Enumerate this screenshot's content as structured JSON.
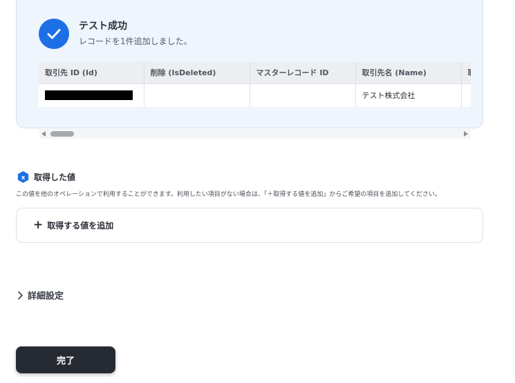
{
  "success": {
    "title": "テスト成功",
    "subtitle": "レコードを1件追加しました。"
  },
  "table": {
    "headers": [
      "取引先 ID (Id)",
      "削除 (IsDeleted)",
      "マスターレコード ID",
      "取引先名 (Name)",
      "取"
    ],
    "row": [
      "",
      "",
      "",
      "テスト株式会社",
      ""
    ]
  },
  "acquired": {
    "title": "取得した値",
    "description": "この値を他のオペレーションで利用することができます。利用したい項目がない場合は、「＋取得する値を追加」からご希望の項目を追加してください。",
    "add_label": "取得する値を追加",
    "icon_letter": "x"
  },
  "advanced": {
    "label": "詳細設定"
  },
  "done_label": "完了",
  "colors": {
    "accent": "#1d6fe6",
    "card_bg": "#eef5fd",
    "button_bg": "#262b33"
  }
}
